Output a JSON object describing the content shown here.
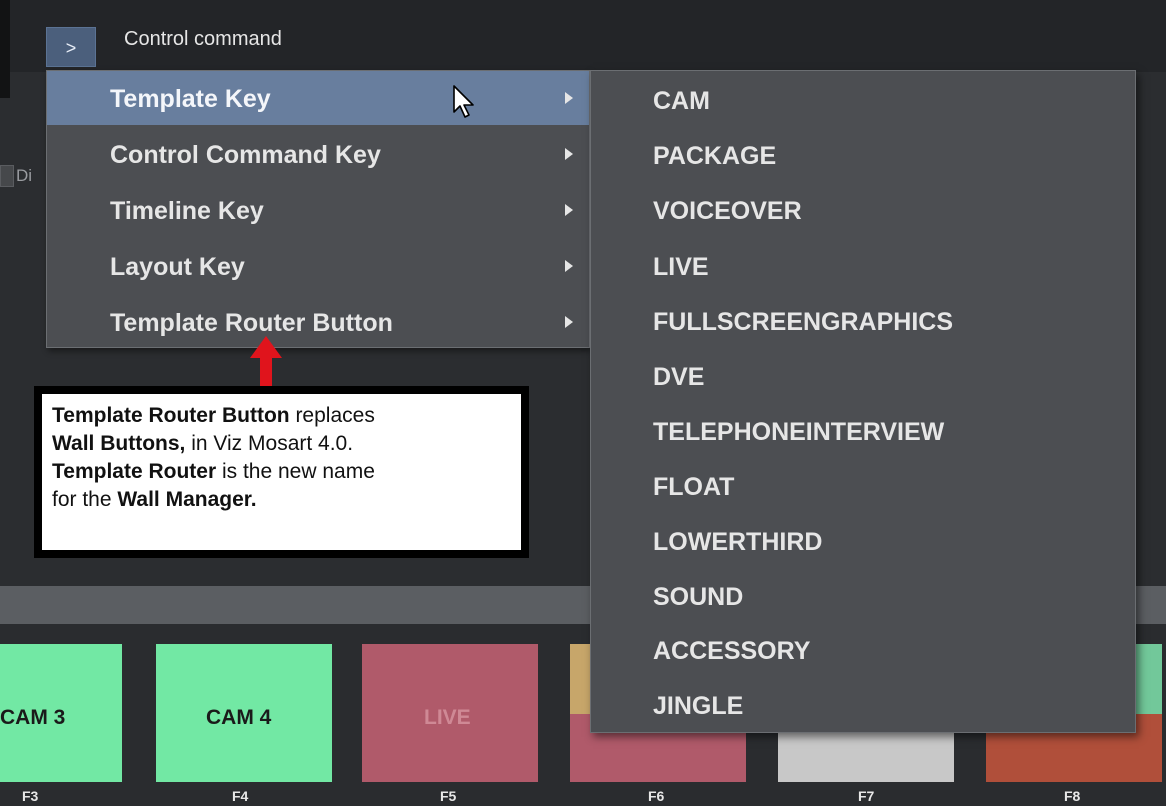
{
  "header": {
    "expand_glyph": ">",
    "title": "Control command"
  },
  "background": {
    "checkbox_label_fragment": "Di"
  },
  "main_menu": {
    "items": [
      {
        "label": "Template Key",
        "active": true
      },
      {
        "label": "Control Command Key",
        "active": false
      },
      {
        "label": "Timeline Key",
        "active": false
      },
      {
        "label": "Layout Key",
        "active": false
      },
      {
        "label": "Template Router Button",
        "active": false
      }
    ]
  },
  "sub_menu": {
    "items": [
      "CAM",
      "PACKAGE",
      "VOICEOVER",
      "LIVE",
      "FULLSCREENGRAPHICS",
      "DVE",
      "TELEPHONEINTERVIEW",
      "FLOAT",
      "LOWERTHIRD",
      "SOUND",
      "ACCESSORY",
      "JINGLE"
    ]
  },
  "note": {
    "line1_bold": "Template Router Button",
    "line1_rest": " replaces",
    "line2_bold": "Wall Buttons,",
    "line2_rest": " in Viz Mosart 4.0.",
    "line3_bold": "Template Router",
    "line3_rest": " is the new name",
    "line4_start": "for the ",
    "line4_bold": "Wall Manager."
  },
  "tiles": [
    {
      "label": "CAM 3",
      "fkey": "F3",
      "color": "#72e8a4"
    },
    {
      "label": "CAM 4",
      "fkey": "F4",
      "color": "#72e8a4"
    },
    {
      "label": "LIVE",
      "fkey": "F5",
      "color": "#b05a6a"
    },
    {
      "label": "",
      "fkey": "F6",
      "color": "#b05a6a"
    },
    {
      "label": "",
      "fkey": "F7",
      "color": "#c8c8c8"
    },
    {
      "label": "",
      "fkey": "F8",
      "color": "#b04f3a"
    }
  ],
  "colors": {
    "menu_bg": "#4c4e52",
    "menu_active": "#687e9e",
    "tile_green": "#72e8a4",
    "tile_red": "#b05a6a",
    "accent_arrow": "#e0141c"
  }
}
